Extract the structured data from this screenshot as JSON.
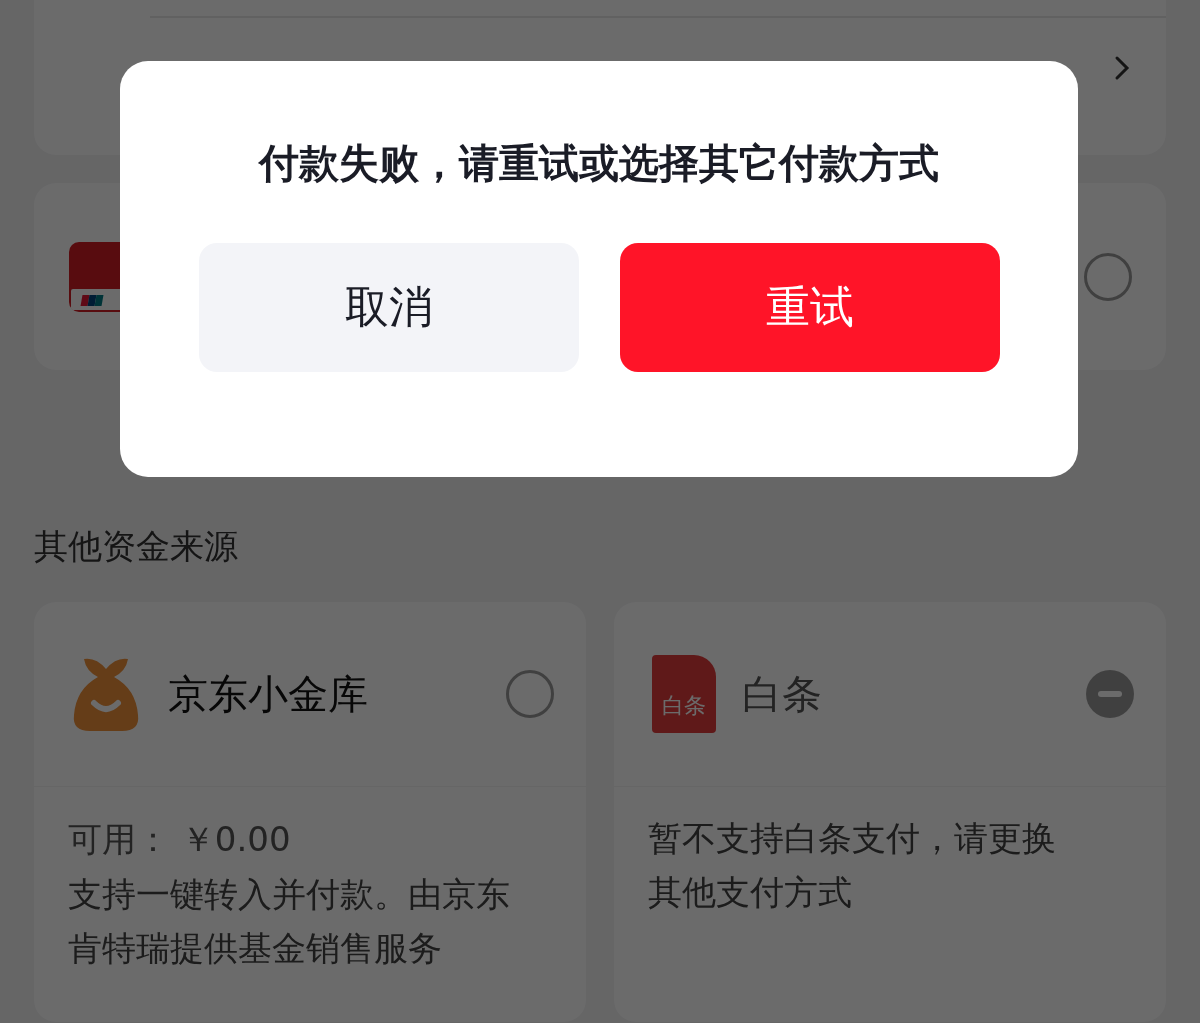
{
  "payment_methods": [
    {
      "kind": "unionpay",
      "selected": false
    }
  ],
  "section_title": "其他资金来源",
  "funds": [
    {
      "kind": "vault",
      "name": "京东小金库",
      "selected": false,
      "disabled": false,
      "balance": "可用： ￥0.00",
      "note": "支持一键转入并付款。由京东肯特瑞提供基金销售服务"
    },
    {
      "kind": "baitiao",
      "name": "白条",
      "icon_text": "白条",
      "selected": false,
      "disabled": true,
      "note": "暂不支持白条支付，请更换其他支付方式"
    }
  ],
  "dialog": {
    "title": "付款失败，请重试或选择其它付款方式",
    "buttons": [
      {
        "label": "取消",
        "kind": "secondary"
      },
      {
        "label": "重试",
        "kind": "primary"
      }
    ]
  }
}
